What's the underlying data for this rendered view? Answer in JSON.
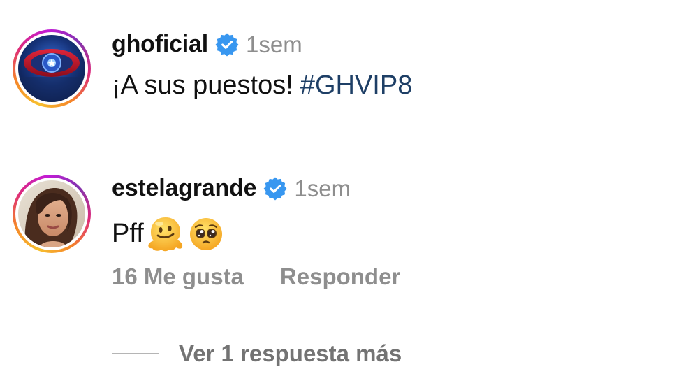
{
  "post": {
    "username": "ghoficial",
    "timestamp": "1sem",
    "text": "¡A sus puestos!",
    "hashtag": "#GHVIP8",
    "avatar_label": "GHVIP",
    "verified": true
  },
  "comment": {
    "username": "estelagrande",
    "timestamp": "1sem",
    "text": "Pff",
    "emojis": [
      "melting-face-emoji",
      "pleading-face-emoji"
    ],
    "likes_label": "16 Me gusta",
    "reply_label": "Responder",
    "view_replies_label": "Ver 1 respuesta más",
    "verified": true
  },
  "colors": {
    "verified_badge": "#3897f0",
    "hashtag": "#1e3f66",
    "muted_text": "#8e8e8e",
    "divider": "#dcdcdc"
  }
}
